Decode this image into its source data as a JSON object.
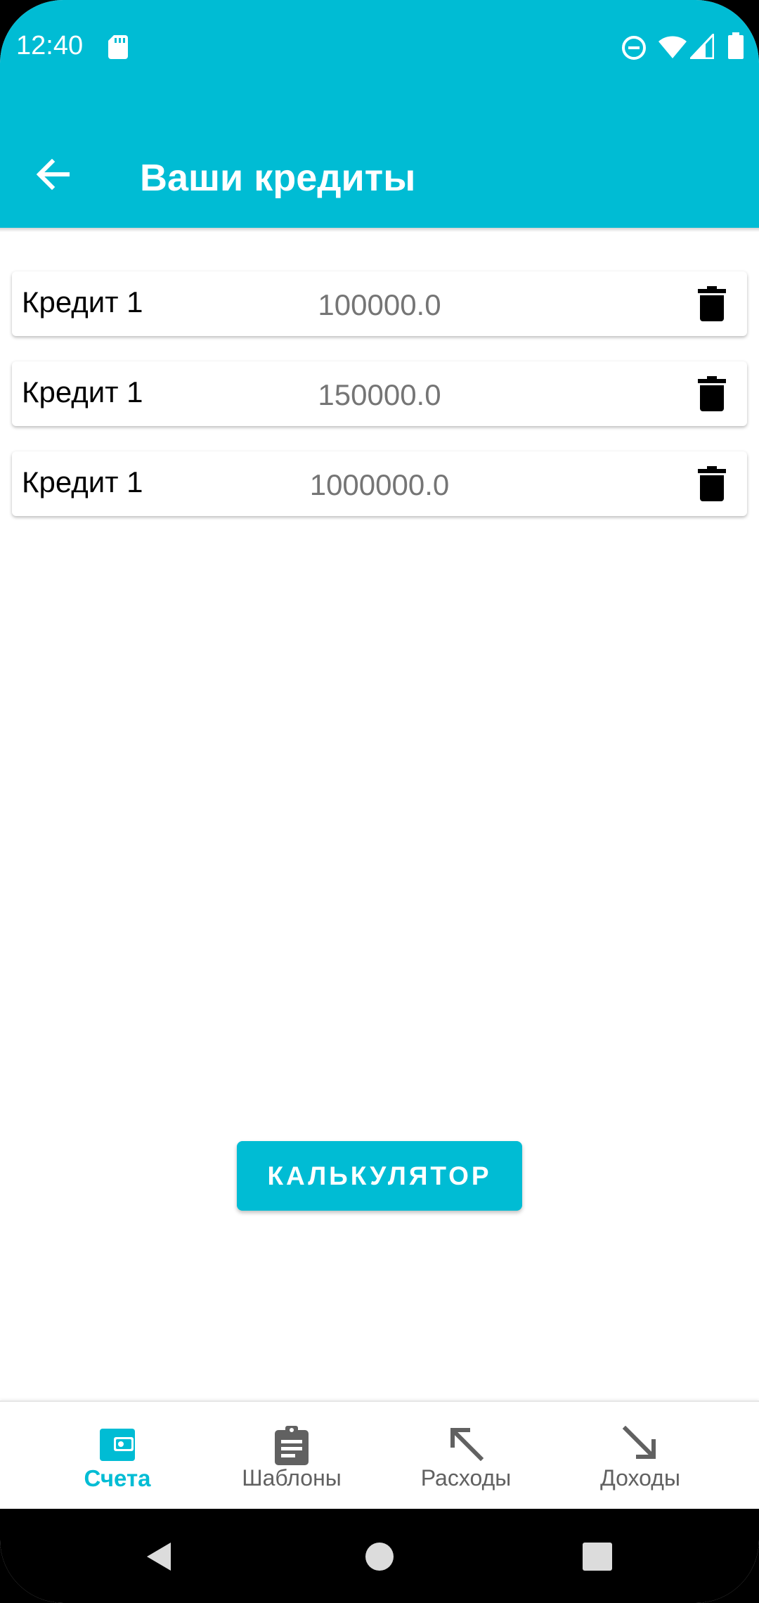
{
  "status_bar": {
    "time": "12:40",
    "icons": [
      "sd-card-icon",
      "do-not-disturb-icon",
      "wifi-icon",
      "signal-icon",
      "battery-icon"
    ]
  },
  "toolbar": {
    "title": "Ваши кредиты",
    "back_icon": "arrow-back-icon",
    "background": "#00BCD4"
  },
  "credits": [
    {
      "name": "Кредит 1",
      "amount": "100000.0"
    },
    {
      "name": "Кредит 1",
      "amount": "150000.0"
    },
    {
      "name": "Кредит 1",
      "amount": "1000000.0"
    }
  ],
  "calculator_button": {
    "label": "КАЛЬКУЛЯТОР"
  },
  "bottom_nav": {
    "items": [
      {
        "label": "Счета",
        "icon": "wallet-icon",
        "active": true
      },
      {
        "label": "Шаблоны",
        "icon": "clipboard-icon",
        "active": false
      },
      {
        "label": "Расходы",
        "icon": "arrow-up-left-icon",
        "active": false
      },
      {
        "label": "Доходы",
        "icon": "arrow-down-right-icon",
        "active": false
      }
    ],
    "active_color": "#00BCD4",
    "inactive_color": "#616161"
  },
  "system_nav": {
    "icons": [
      "back-triangle-icon",
      "home-circle-icon",
      "recents-square-icon"
    ]
  }
}
